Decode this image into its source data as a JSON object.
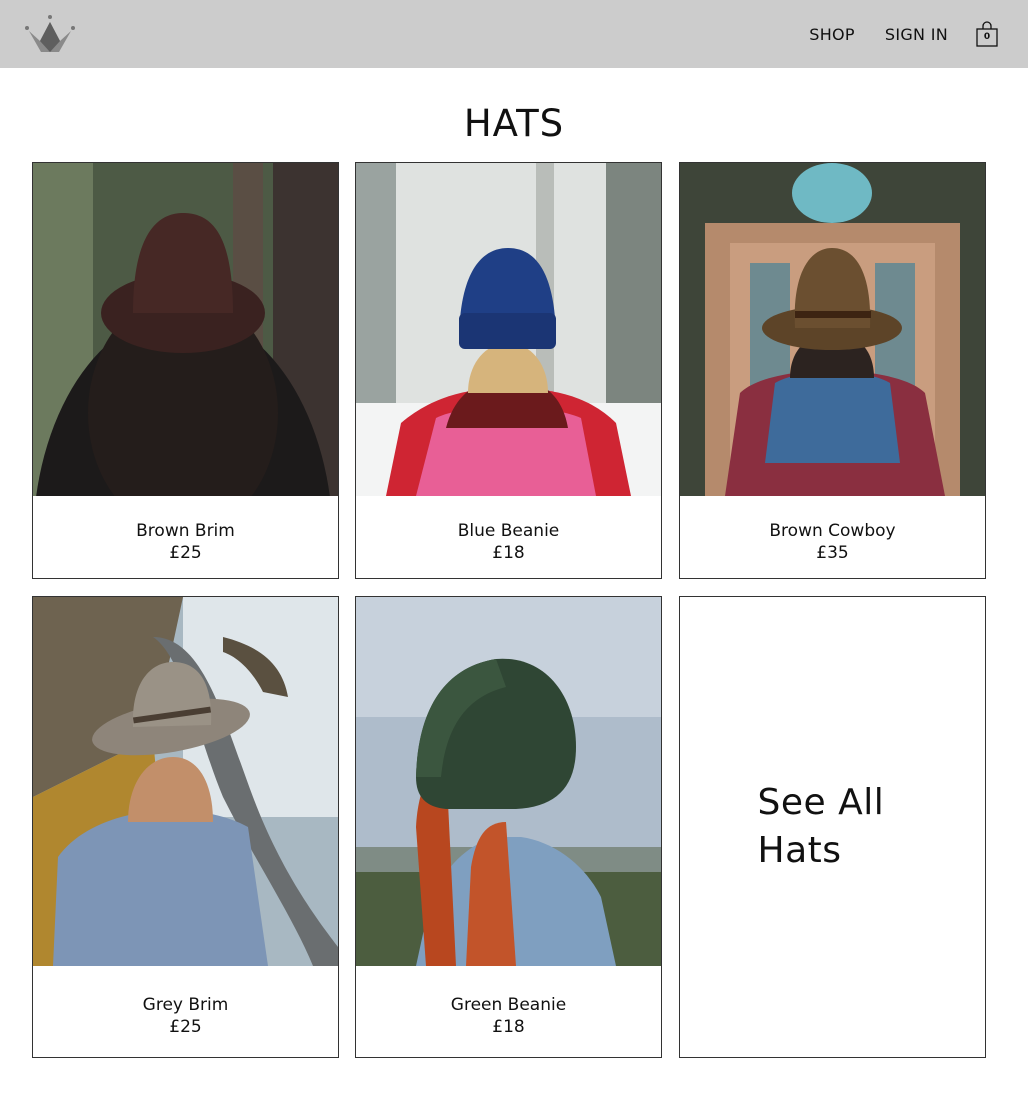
{
  "header": {
    "nav": {
      "shop": "SHOP",
      "sign_in": "SIGN IN"
    },
    "cart_count": "0",
    "logo_icon": "crown-icon"
  },
  "page": {
    "title": "HATS"
  },
  "products": [
    {
      "name": "Brown Brim",
      "price": "£25"
    },
    {
      "name": "Blue Beanie",
      "price": "£18"
    },
    {
      "name": "Brown Cowboy",
      "price": "£35"
    },
    {
      "name": "Grey Brim",
      "price": "£25"
    },
    {
      "name": "Green Beanie",
      "price": "£18"
    }
  ],
  "see_all": {
    "label": "See All Hats"
  },
  "colors": {
    "header_bg": "#cccccc",
    "border": "#333333",
    "text": "#111111"
  }
}
